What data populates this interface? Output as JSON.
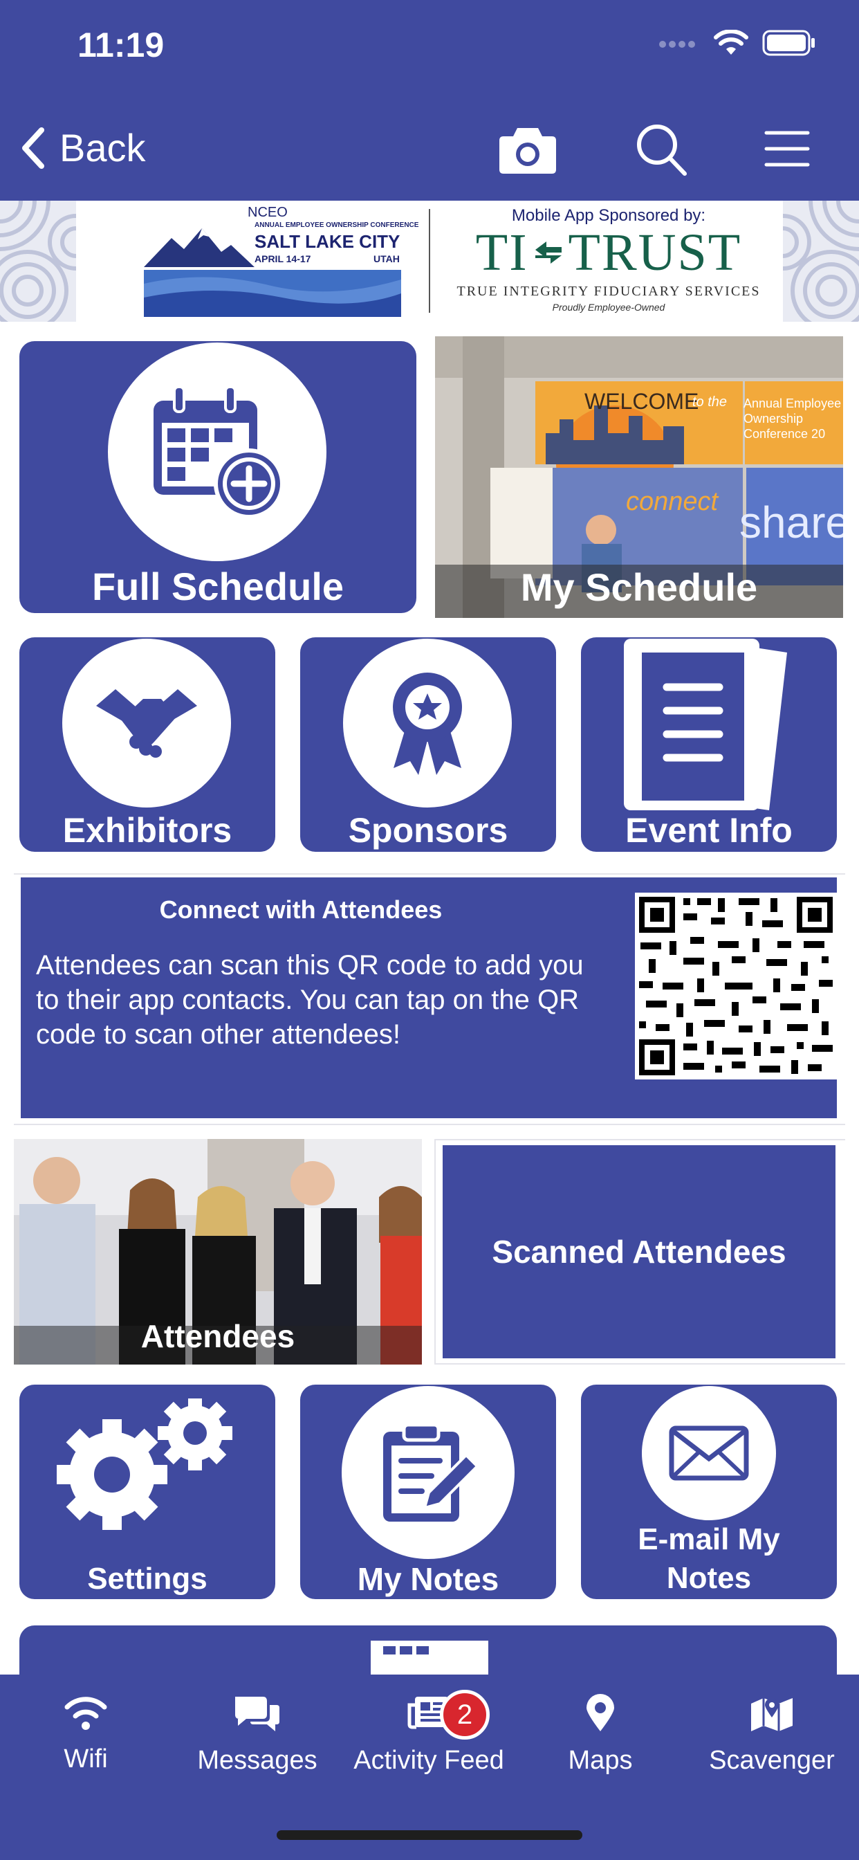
{
  "status_bar": {
    "time": "11:19"
  },
  "nav": {
    "back_label": "Back"
  },
  "banner": {
    "org": "NCEO",
    "conference_line": "ANNUAL EMPLOYEE OWNERSHIP CONFERENCE",
    "city": "SALT LAKE CITY",
    "dates": "APRIL 14-17",
    "state": "UTAH",
    "sponsor_intro": "Mobile App Sponsored by:",
    "sponsor_name_left": "TI",
    "sponsor_name_right": "TRUST",
    "sponsor_tagline": "TRUE INTEGRITY FIDUCIARY SERVICES",
    "sponsor_subline": "Proudly Employee-Owned"
  },
  "tiles": {
    "full_schedule": "Full Schedule",
    "my_schedule": "My Schedule",
    "exhibitors": "Exhibitors",
    "sponsors": "Sponsors",
    "event_info": "Event Info",
    "attendees": "Attendees",
    "scanned_attendees": "Scanned Attendees",
    "settings": "Settings",
    "my_notes": "My Notes",
    "email_my_notes": "E-mail My Notes"
  },
  "my_schedule_photo": {
    "welcome": "WELCOME",
    "to_the": "to the",
    "sign_right": "Annual Employee Ownership Conference 20",
    "connect": "connect",
    "share": "share"
  },
  "qr_panel": {
    "title": "Connect with Attendees",
    "body": "Attendees can scan this QR code to add you to their app contacts.  You can tap on the QR code to scan other attendees!"
  },
  "tabbar": {
    "items": [
      {
        "label": "Wifi",
        "icon": "wifi-icon"
      },
      {
        "label": "Messages",
        "icon": "messages-icon"
      },
      {
        "label": "Activity Feed",
        "icon": "newspaper-icon",
        "badge": "2"
      },
      {
        "label": "Maps",
        "icon": "map-pin-icon"
      },
      {
        "label": "Scavenger",
        "icon": "map-icon"
      }
    ]
  },
  "colors": {
    "brand": "#404a9f",
    "badge": "#d8262e"
  }
}
